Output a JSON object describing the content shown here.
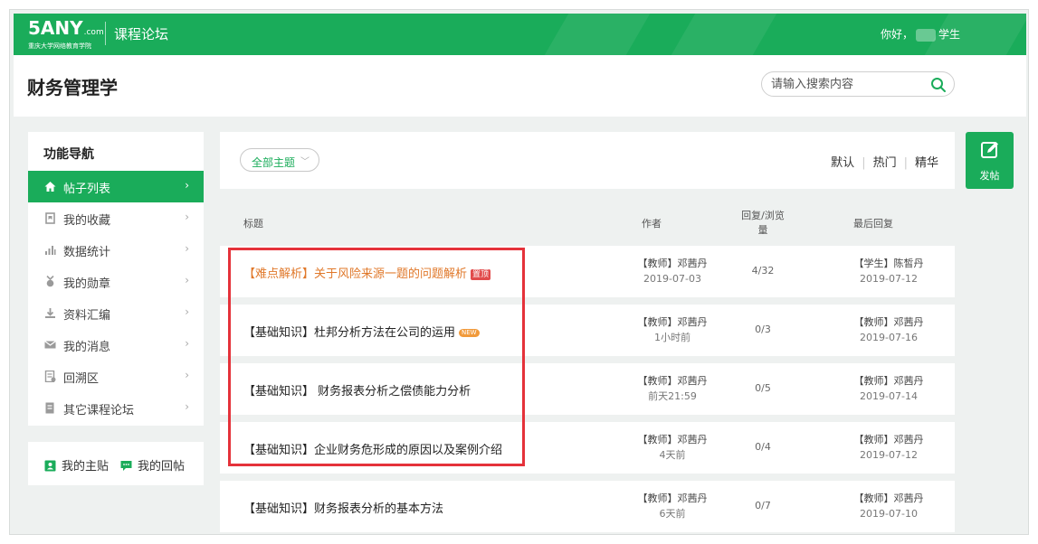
{
  "topbar": {
    "logo_main": "5ANY",
    "logo_com": ".com",
    "logo_sub": "重庆大学网络教育学院",
    "forum_title": "课程论坛",
    "greeting_prefix": "你好，",
    "greeting_suffix": "学生"
  },
  "header": {
    "course_title": "财务管理学",
    "search_placeholder": "请输入搜索内容"
  },
  "sidebar": {
    "title": "功能导航",
    "items": [
      {
        "label": "帖子列表",
        "icon": "home-icon",
        "active": true
      },
      {
        "label": "我的收藏",
        "icon": "bookmark-icon",
        "active": false
      },
      {
        "label": "数据统计",
        "icon": "bar-chart-icon",
        "active": false
      },
      {
        "label": "我的勋章",
        "icon": "medal-icon",
        "active": false
      },
      {
        "label": "资料汇编",
        "icon": "download-icon",
        "active": false
      },
      {
        "label": "我的消息",
        "icon": "mail-icon",
        "active": false
      },
      {
        "label": "回溯区",
        "icon": "document-icon",
        "active": false
      },
      {
        "label": "其它课程论坛",
        "icon": "document-icon",
        "active": false
      }
    ],
    "chevron": "›",
    "my_topics": "我的主贴",
    "my_replies": "我的回帖"
  },
  "filter": {
    "topic_select": "全部主题",
    "sort_default": "默认",
    "sort_hot": "热门",
    "sort_featured": "精华"
  },
  "post_button": {
    "label": "发帖"
  },
  "table": {
    "col_title": "标题",
    "col_author": "作者",
    "col_reply_line1": "回复/浏览",
    "col_reply_line2": "量",
    "col_last": "最后回复",
    "rows": [
      {
        "title": "【难点解析】关于风险来源一题的问题解析",
        "badge": "置顶",
        "badge_type": "top",
        "highlight": true,
        "author": "【教师】邓茜丹",
        "author_time": "2019-07-03",
        "replies": "4/32",
        "last_user": "【学生】陈皙丹",
        "last_time": "2019-07-12"
      },
      {
        "title": "【基础知识】杜邦分析方法在公司的运用",
        "badge": "NEW",
        "badge_type": "new",
        "highlight": false,
        "author": "【教师】邓茜丹",
        "author_time": "1小时前",
        "replies": "0/3",
        "last_user": "【教师】邓茜丹",
        "last_time": "2019-07-16"
      },
      {
        "title": "【基础知识】 财务报表分析之偿债能力分析",
        "badge": "",
        "badge_type": "",
        "highlight": false,
        "author": "【教师】邓茜丹",
        "author_time": "前天21:59",
        "replies": "0/5",
        "last_user": "【教师】邓茜丹",
        "last_time": "2019-07-14"
      },
      {
        "title": "【基础知识】企业财务危形成的原因以及案例介绍",
        "badge": "",
        "badge_type": "",
        "highlight": false,
        "author": "【教师】邓茜丹",
        "author_time": "4天前",
        "replies": "0/4",
        "last_user": "【教师】邓茜丹",
        "last_time": "2019-07-12"
      },
      {
        "title": "【基础知识】财务报表分析的基本方法",
        "badge": "",
        "badge_type": "",
        "highlight": false,
        "author": "【教师】邓茜丹",
        "author_time": "6天前",
        "replies": "0/7",
        "last_user": "【教师】邓茜丹",
        "last_time": "2019-07-10"
      }
    ]
  },
  "colors": {
    "brand": "#1aac5a",
    "highlight": "#e0782a",
    "annotation": "#e5323a"
  }
}
